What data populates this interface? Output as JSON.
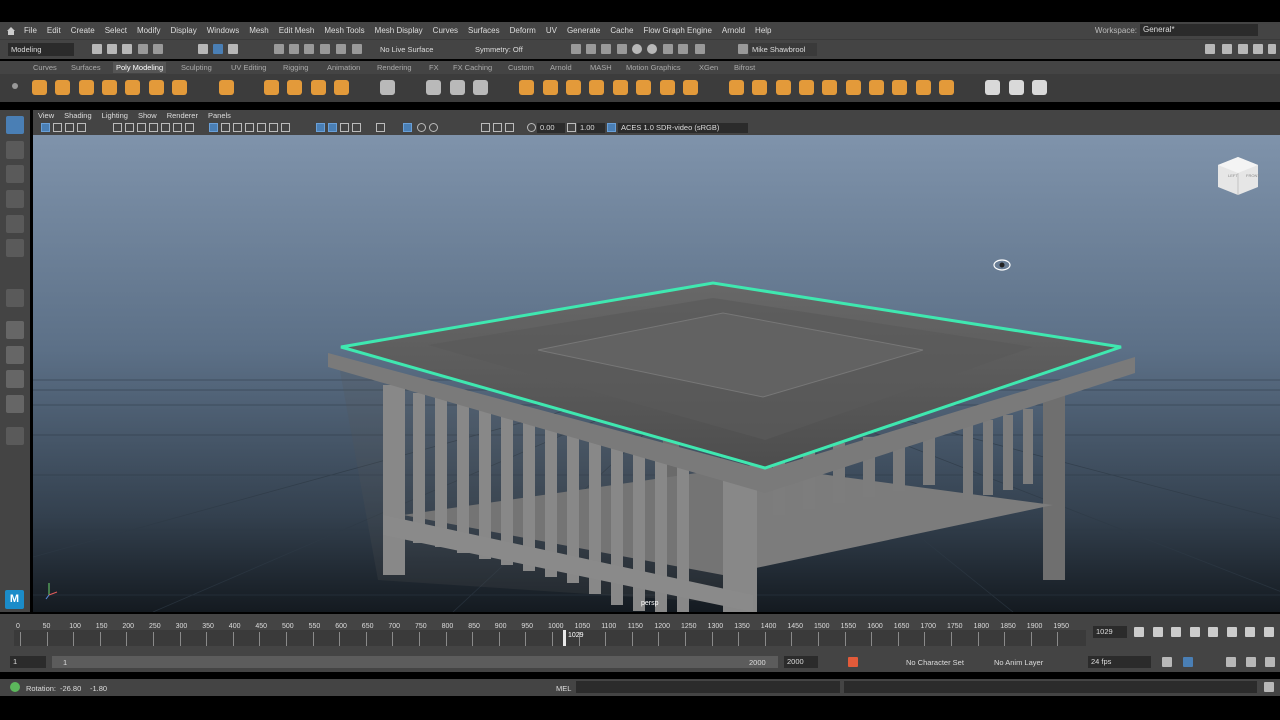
{
  "menubar": {
    "items": [
      "File",
      "Edit",
      "Create",
      "Select",
      "Modify",
      "Display",
      "Windows",
      "Mesh",
      "Edit Mesh",
      "Mesh Tools",
      "Mesh Display",
      "Curves",
      "Surfaces",
      "Deform",
      "UV",
      "Generate",
      "Cache",
      "Flow Graph Engine",
      "Arnold",
      "Help"
    ],
    "workspace_label": "Workspace:",
    "workspace_value": "General*"
  },
  "statusline": {
    "mode": "Modeling",
    "live_surface": "No Live Surface",
    "symmetry": "Symmetry: Off",
    "user": "Mike Shawbrool"
  },
  "shelf": {
    "tabs": [
      "Curves",
      "Surfaces",
      "Poly Modeling",
      "Sculpting",
      "UV Editing",
      "Rigging",
      "Animation",
      "Rendering",
      "FX",
      "FX Caching",
      "Custom",
      "Arnold",
      "MASH",
      "Motion Graphics",
      "XGen",
      "Bifrost"
    ],
    "active_tab": "Poly Modeling"
  },
  "panel": {
    "menus": [
      "View",
      "Shading",
      "Lighting",
      "Show",
      "Renderer",
      "Panels"
    ],
    "exposure": "0.00",
    "gamma": "1.00",
    "color_space": "ACES 1.0 SDR-video (sRGB)",
    "camera_label": "persp",
    "viewcube": {
      "left": "LEFT",
      "front": "FRONT"
    }
  },
  "timeline": {
    "ticks": [
      "0",
      "50",
      "100",
      "150",
      "200",
      "250",
      "300",
      "350",
      "400",
      "450",
      "500",
      "550",
      "600",
      "650",
      "700",
      "750",
      "800",
      "850",
      "900",
      "950",
      "1000",
      "1050",
      "1100",
      "1150",
      "1200",
      "1250",
      "1300",
      "1350",
      "1400",
      "1450",
      "1500",
      "1550",
      "1600",
      "1650",
      "1700",
      "1750",
      "1800",
      "1850",
      "1900",
      "1950"
    ],
    "current_frame_marker": "1029",
    "current_frame": "1029"
  },
  "range": {
    "start": "1",
    "range_start": "1",
    "range_end": "2000",
    "end": "2000",
    "character_set": "No Character Set",
    "anim_layer": "No Anim Layer",
    "fps": "24 fps"
  },
  "helpline": {
    "rotation_label": "Rotation:",
    "rot_x": "-26.80",
    "rot_y": "-1.80",
    "mel_label": "MEL"
  },
  "colors": {
    "ui_bg": "#444444",
    "selection_outline": "#3fe8b0",
    "shelf_icon": "#e39a3a",
    "accent_blue": "#4a7fb5"
  }
}
